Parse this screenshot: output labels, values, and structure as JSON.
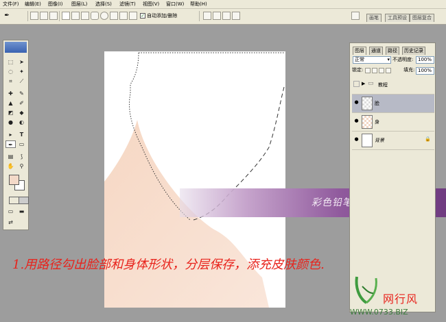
{
  "menu": [
    "文件(F)",
    "编辑(E)",
    "图像(I)",
    "图层(L)",
    "选择(S)",
    "滤镜(T)",
    "视图(V)",
    "窗口(W)",
    "帮助(H)"
  ],
  "options_bar": {
    "auto_add_delete": "自动添加/删除",
    "auto_add_checked": true
  },
  "palette_well_tabs": [
    "画笔",
    "工具预设",
    "图层复合"
  ],
  "layers_panel": {
    "tabs": [
      "图层",
      "通道",
      "路径",
      "历史记录"
    ],
    "blend_mode": "正常",
    "opacity_label": "不透明度:",
    "opacity_value": "100%",
    "lock_label": "锁定:",
    "fill_label": "填充:",
    "fill_value": "100%",
    "layers": [
      {
        "name": "教程",
        "type": "group",
        "visible": false,
        "selected": false
      },
      {
        "name": "脸",
        "type": "layer",
        "visible": true,
        "selected": true
      },
      {
        "name": "身",
        "type": "layer",
        "visible": true,
        "selected": false
      },
      {
        "name": "背景",
        "type": "background",
        "visible": true,
        "selected": false,
        "locked": true
      }
    ]
  },
  "banner_text": "彩色铅笔-靖 原创教程",
  "caption": "1.用路径勾出脸部和身体形状，分层保存，添充皮肤颜色.",
  "watermark": {
    "logo_text": "网行风",
    "url": "WWW.0733.BIZ"
  },
  "colors": {
    "foreground": "#f3d9c8",
    "background": "#ffffff",
    "banner": "#905a9d",
    "caption": "#e8231c"
  }
}
